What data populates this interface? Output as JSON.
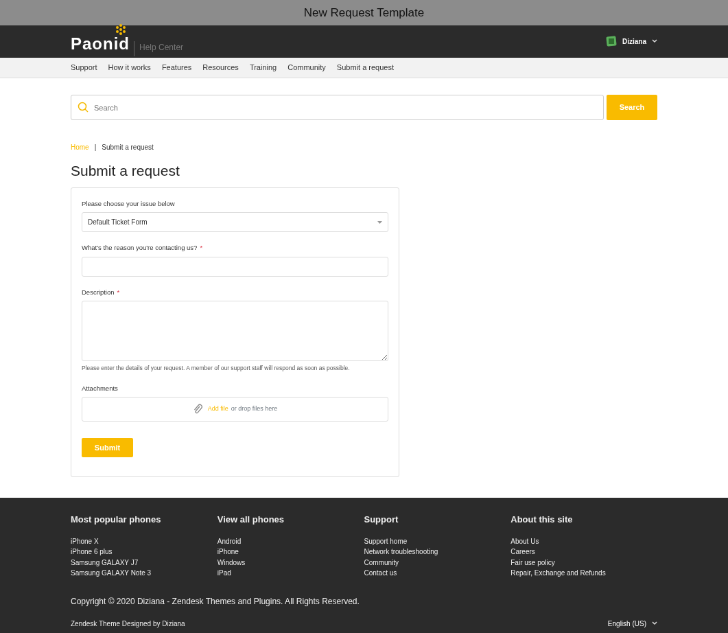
{
  "window": {
    "title": "New Request Template"
  },
  "header": {
    "logo": "Paonid",
    "subtitle": "Help Center",
    "user": "Diziana"
  },
  "nav": [
    "Support",
    "How it works",
    "Features",
    "Resources",
    "Training",
    "Community",
    "Submit a request"
  ],
  "search": {
    "placeholder": "Search",
    "button": "Search"
  },
  "breadcrumb": [
    {
      "label": "Home",
      "link": true
    },
    {
      "label": "Submit a request",
      "link": false
    }
  ],
  "breadcrumb_separator": "|",
  "page_title": "Submit a request",
  "form": {
    "fields": [
      {
        "kind": "select",
        "label": "Please choose your issue below",
        "value": "Default Ticket Form"
      },
      {
        "kind": "text",
        "label": "What's the reason you're contacting us?",
        "required_mark": "*"
      },
      {
        "kind": "textarea",
        "label": "Description",
        "required_mark": "*",
        "hint": "Please enter the details of your request. A member of our support staff will respond as soon as possible."
      },
      {
        "kind": "attachment",
        "label": "Attachments",
        "link": "Add file",
        "rest": "or drop files here"
      }
    ],
    "submit": "Submit"
  },
  "footer": {
    "columns": [
      {
        "title": "Most popular phones",
        "links": [
          "iPhone X",
          "iPhone 6 plus",
          "Samsung GALAXY J7",
          "Samsung GALAXY Note 3"
        ]
      },
      {
        "title": "View all phones",
        "links": [
          "Android",
          "iPhone",
          "Windows",
          "iPad"
        ]
      },
      {
        "title": "Support",
        "links": [
          "Support home",
          "Network troubleshooting",
          "Community",
          "Contact us"
        ]
      },
      {
        "title": "About this site",
        "links": [
          "About Us",
          "Careers",
          "Fair use policy",
          "Repair, Exchange and Refunds"
        ]
      }
    ],
    "copyright": "Copyright © 2020 Diziana - Zendesk Themes and Plugins. All Rights Reserved.",
    "credit": "Zendesk Theme Designed by Diziana",
    "language": "English (US)"
  }
}
